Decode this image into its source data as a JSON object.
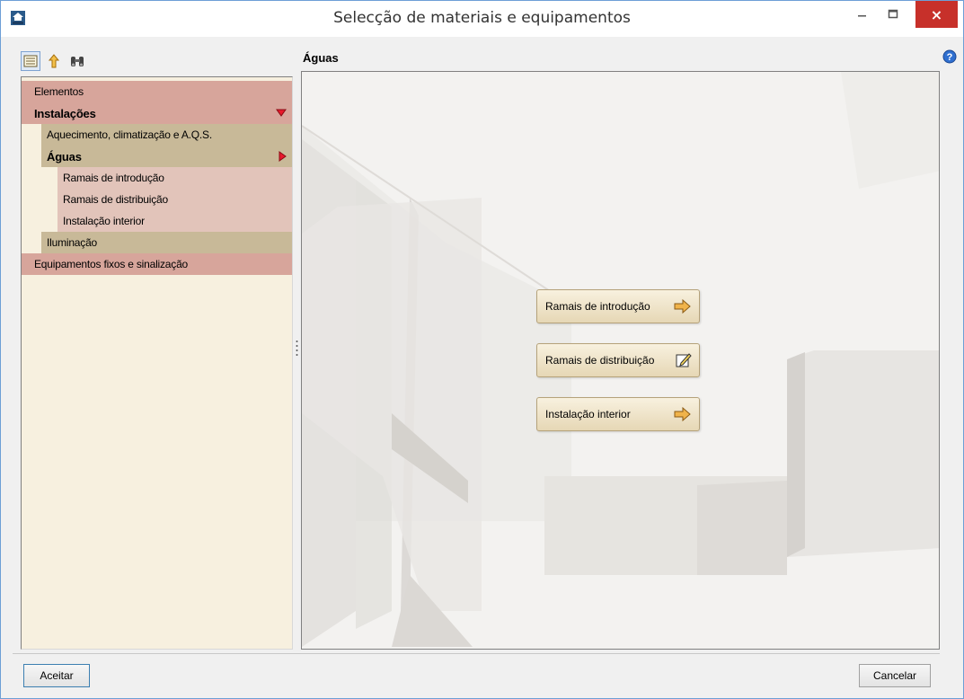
{
  "window": {
    "title": "Selecção de materiais e equipamentos",
    "app_icon": "mep-app-icon",
    "close_label": "×"
  },
  "left_toolbar": {
    "icons": [
      "tree-view-icon",
      "up-level-icon",
      "find-binoculars-icon"
    ]
  },
  "tree": {
    "items": [
      {
        "label": "Elementos",
        "level": 0
      },
      {
        "label": "Instalações",
        "level": 0,
        "bold": true,
        "expanded": true
      },
      {
        "label": "Aquecimento, climatização e A.Q.S.",
        "level": 1
      },
      {
        "label": "Águas",
        "level": 1,
        "bold": true,
        "selected": true
      },
      {
        "label": "Ramais de introdução",
        "level": 2
      },
      {
        "label": "Ramais de distribuição",
        "level": 2
      },
      {
        "label": "Instalação interior",
        "level": 2
      },
      {
        "label": "Iluminação",
        "level": 1
      },
      {
        "label": "Equipamentos fixos e sinalização",
        "level": 0
      }
    ]
  },
  "content": {
    "header": "Águas",
    "buttons": [
      {
        "label": "Ramais de introdução",
        "icon": "arrow-right-icon"
      },
      {
        "label": "Ramais de distribuição",
        "icon": "edit-pencil-icon"
      },
      {
        "label": "Instalação interior",
        "icon": "arrow-right-icon"
      }
    ]
  },
  "footer": {
    "accept_label": "Aceitar",
    "cancel_label": "Cancelar"
  },
  "colors": {
    "level0_bg": "#d7a59b",
    "level1_bg": "#c8b998",
    "level2_bg": "#e2c4ba",
    "tree_bg": "#f7f0df",
    "close_red": "#c7302a"
  }
}
